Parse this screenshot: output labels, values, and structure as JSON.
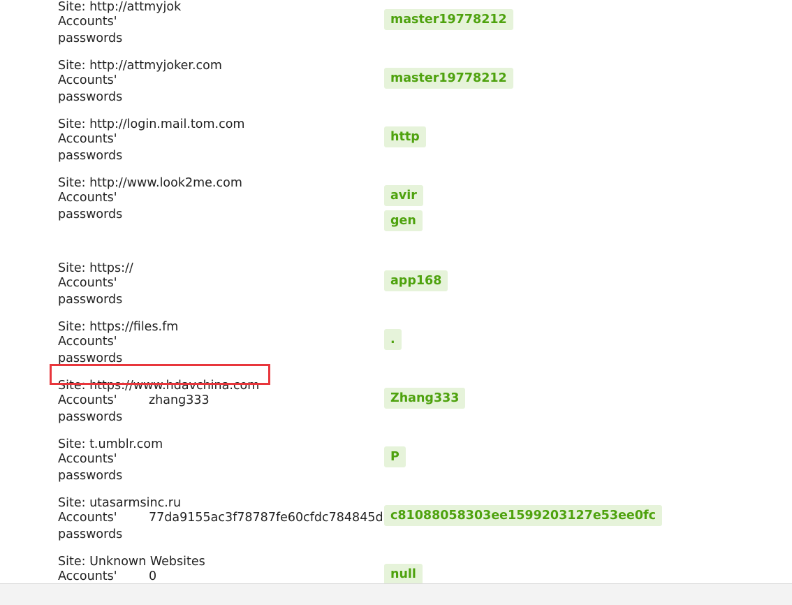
{
  "labels": {
    "site_prefix": "Site: ",
    "accounts_line1": "Accounts'",
    "accounts_line2": "passwords"
  },
  "entries": [
    {
      "site": "http://attmyjok",
      "username": "",
      "passwords": [
        "master19778212"
      ]
    },
    {
      "site": "http://attmyjoker.com",
      "username": "",
      "passwords": [
        "master19778212"
      ]
    },
    {
      "site": "http://login.mail.tom.com",
      "username": "",
      "passwords": [
        "http"
      ]
    },
    {
      "site": "http://www.look2me.com",
      "username": "",
      "passwords": [
        "avir",
        "gen"
      ]
    },
    {
      "site": "https://",
      "username": "",
      "passwords": [
        "app168"
      ]
    },
    {
      "site": "https://files.fm",
      "username": "",
      "passwords": [
        "."
      ]
    },
    {
      "site": "https://www.hdavchina.com",
      "username": "zhang333",
      "passwords": [
        "Zhang333"
      ],
      "highlighted": true
    },
    {
      "site": "t.umblr.com",
      "username": "",
      "passwords": [
        "P"
      ]
    },
    {
      "site": "utasarmsinc.ru",
      "username": "77da9155ac3f78787fe60cfdc784845d",
      "passwords": [
        "c81088058303ee1599203127e53ee0fc"
      ]
    },
    {
      "site": "Unknown Websites",
      "username": "0",
      "passwords": [
        "null"
      ]
    }
  ],
  "colors": {
    "password_text": "#4ea20e",
    "password_bg": "#e6f3da",
    "highlight_border": "#e8363c",
    "bottom_bar": "#f3f3f3"
  }
}
